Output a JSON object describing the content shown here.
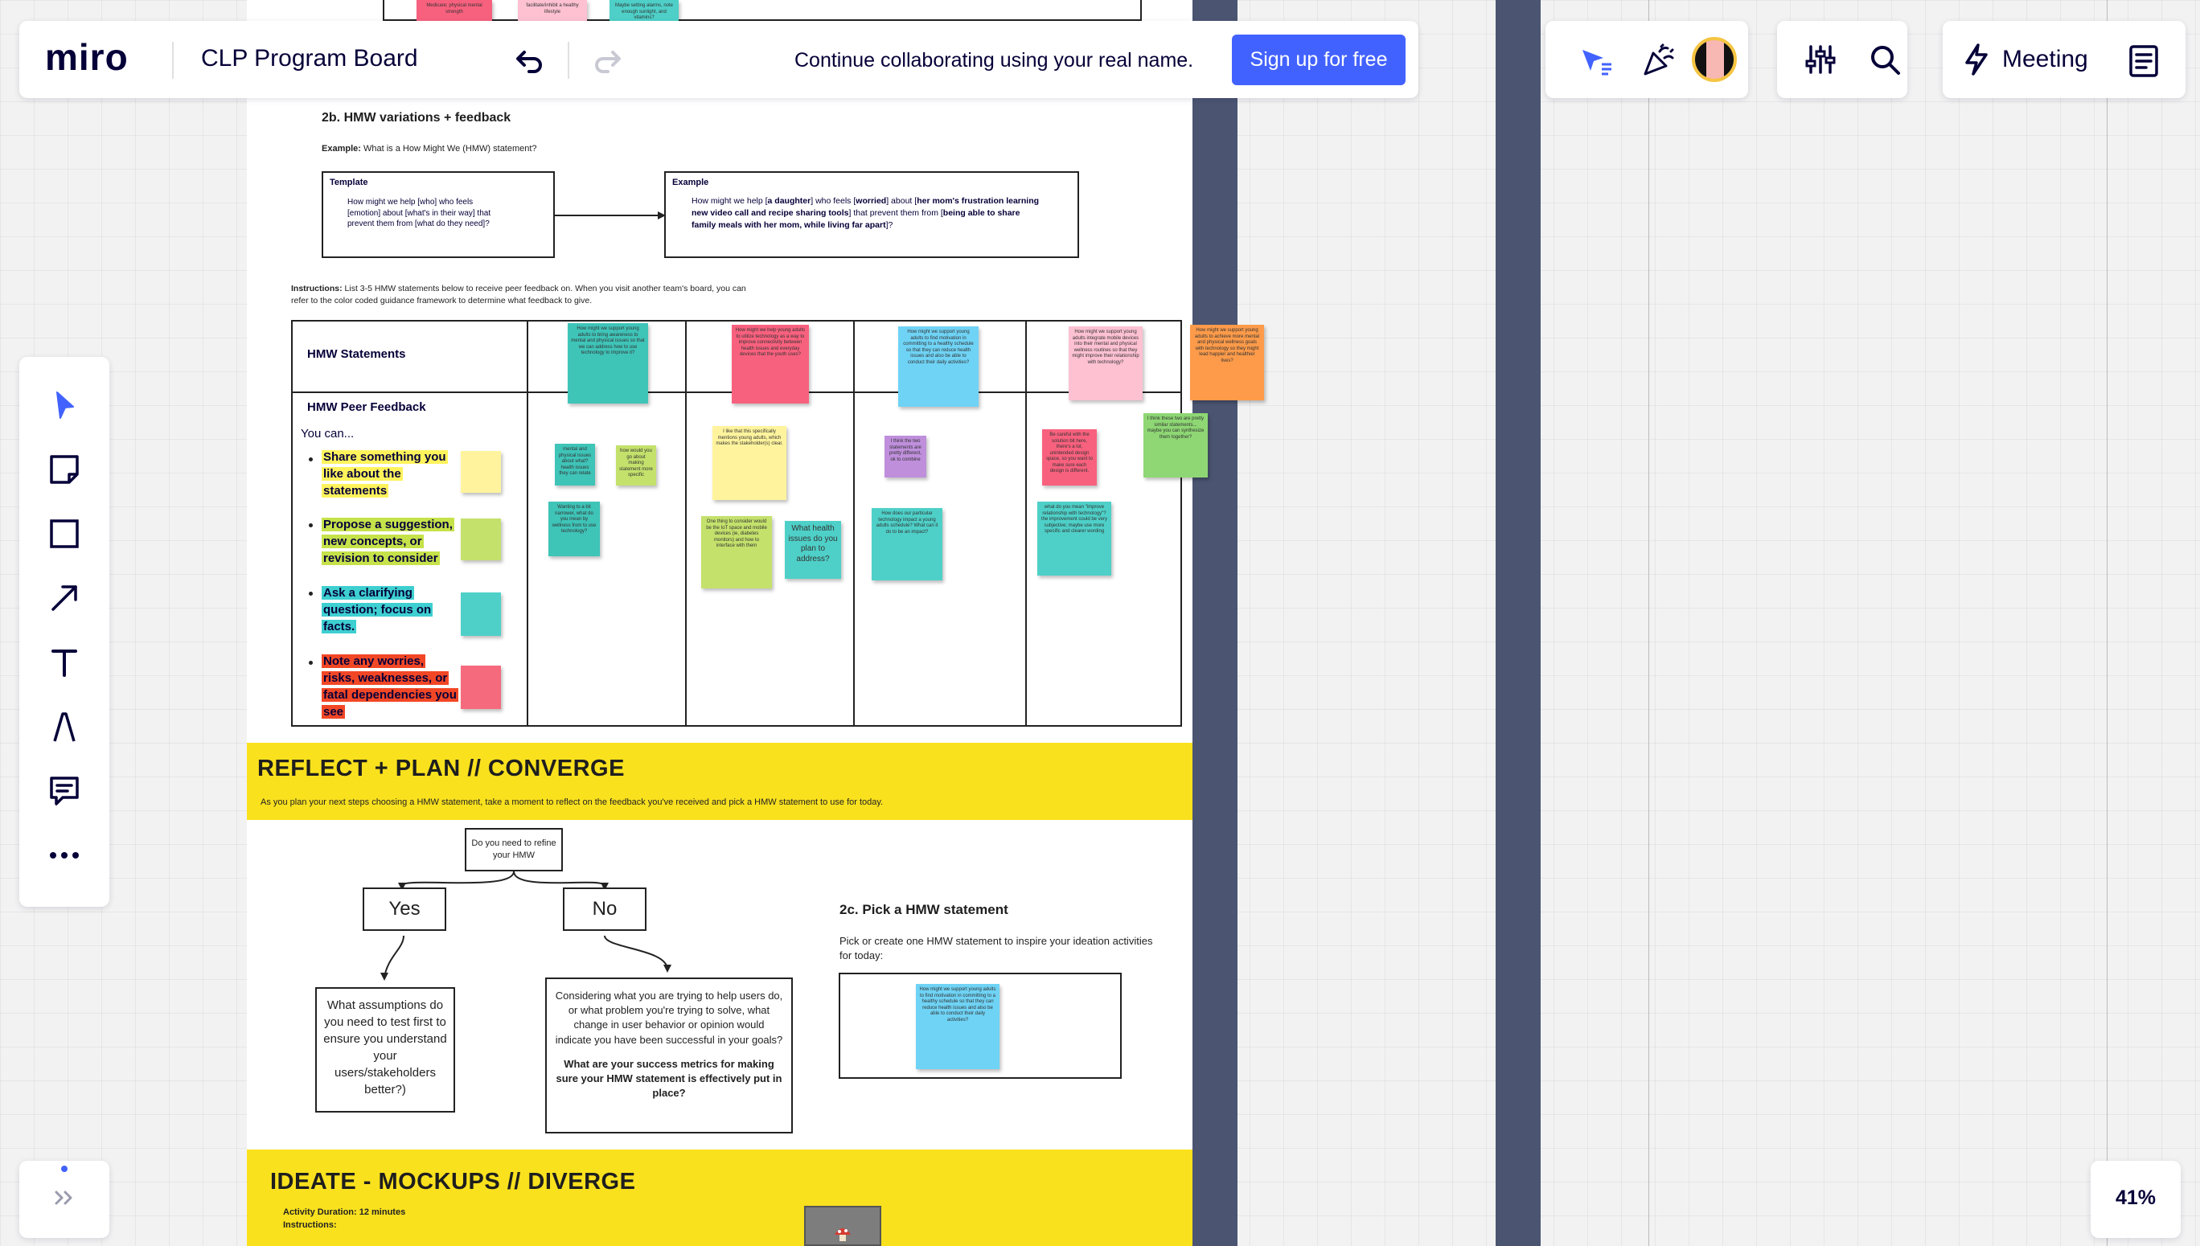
{
  "app": {
    "logo": "miro",
    "board_title": "CLP Program Board",
    "collab_message": "Continue collaborating using your real name.",
    "signup_label": "Sign up for free",
    "meeting_label": "Meeting",
    "zoom_level": "41%",
    "accent_color": "#4262ff"
  },
  "toolbar": {
    "tools": [
      {
        "name": "select-icon"
      },
      {
        "name": "sticky-note-icon"
      },
      {
        "name": "shape-icon"
      },
      {
        "name": "arrow-icon"
      },
      {
        "name": "text-icon"
      },
      {
        "name": "pen-icon"
      },
      {
        "name": "comment-icon"
      },
      {
        "name": "more-icon"
      }
    ]
  },
  "board": {
    "top_stickies": [
      "Medicare; physical mental strength",
      "facilitate/inhibit a healthy lifestyle",
      "Maybe setting alarms, note enough sunlight, and vitamins?"
    ],
    "hmw_section": {
      "title": "2b. HMW variations + feedback",
      "example_prefix": "Example:",
      "example_text": "What is a How Might We (HMW) statement?",
      "template_label": "Template",
      "template_text": "How might we help [who] who feels [emotion] about [what's in their way] that prevent them from [what do they need]?",
      "example_label": "Example",
      "example_1": "How might we help ",
      "example_2": "a daughter",
      "example_3": " who feels ",
      "example_4": "worried",
      "example_5": " about ",
      "example_6": "her mom's frustration learning new video call and recipe sharing tools",
      "example_7": " that prevent them from ",
      "example_8": "being able to share family meals with her mom, while living far apart",
      "example_9": "]?",
      "instructions_prefix": "Instructions:",
      "instructions_text": "List 3-5 HMW statements below to receive peer feedback on. When you visit another team's board, you can refer to the color coded guidance framework to determine what feedback to give.",
      "row1_label": "HMW Statements",
      "row2_label": "HMW Peer Feedback",
      "you_can": "You can...",
      "legend": [
        {
          "text": "Share something you like about the statements",
          "color": "#fff35c"
        },
        {
          "text": "Propose a suggestion, new concepts, or revision to consider",
          "color": "#c6e24a"
        },
        {
          "text": "Ask a clarifying question; focus on facts.",
          "color": "#3ecfd0"
        },
        {
          "text": "Note any worries, risks, weaknesses, or fatal dependencies you see",
          "color": "#f24726"
        }
      ],
      "statement_stickies": [
        "How might we support young adults to bring awareness to mental and physical issues so that we can address how to use technology to improve it?",
        "How might we help young adults to utilize technology as a way to improve connectivity between health issues and everyday devices that the youth uses?",
        "How might we support young adults to find motivation in committing to a healthy schedule so that they can reduce health issues and also be able to conduct their daily activities?",
        "How might we support young adults integrate mobile devices into their mental and physical wellness routines so that they might improve their relationship with technology?",
        "How might we support young adults to achieve more mental and physical wellness goals with technology so they might lead happier and healthier lives?"
      ],
      "feedback_stickies": [
        "mental and physical issues about what? health issues they can relate",
        "how would you go about making statement more specific",
        "Wanting to a bit narrower, what do you mean by wellness from to use technology?",
        "I like that this specifically mentions young adults, which makes the stakeholder(s) clear.",
        "One thing to consider would be the IoT space and mobile devices (ie, diabetes monitors) and how to interface with them",
        "What health issues do you plan to address?",
        "I think the two statements are pretty different, ok to combine",
        "How does our particular technology impact a young adults schedule? What can it do to be an impact?",
        "Be careful with the solution bit here, there's a lot, unintended design space, so you want to make sure each design is different.",
        "what do you mean \"improve relationship with technology\"? the improvement could be very subjective; maybe use more specific and clearer wording",
        "I think these two are pretty similar statements... maybe you can synthesize them together?"
      ]
    },
    "reflect": {
      "title": "REFLECT + PLAN // CONVERGE",
      "subtitle": "As you plan your next steps choosing a HMW statement, take a moment to reflect on the feedback you've received and pick a HMW statement to use for today.",
      "question": "Do you need to refine your HMW",
      "yes": "Yes",
      "no": "No",
      "yes_text": "What assumptions do you need to test first to ensure you understand your users/stakeholders better?)",
      "no_text": "Considering what you are trying to help users do, or what problem you're trying to solve, what change in user behavior or opinion would indicate you have been successful in your goals?",
      "no_bold": "What are your success metrics for making sure your HMW statement is effectively put in place?",
      "pick_title": "2c. Pick a HMW statement",
      "pick_text": "Pick or create one HMW statement to inspire your ideation activities for today:",
      "pick_sticky": "How might we support young adults to find motivation in committing to a healthy schedule so that they can reduce health issues and also be able to conduct their daily activities?"
    },
    "ideate": {
      "title": "IDEATE - MOCKUPS // DIVERGE",
      "duration": "Activity Duration: 12 minutes",
      "instructions": "Instructions:"
    }
  }
}
